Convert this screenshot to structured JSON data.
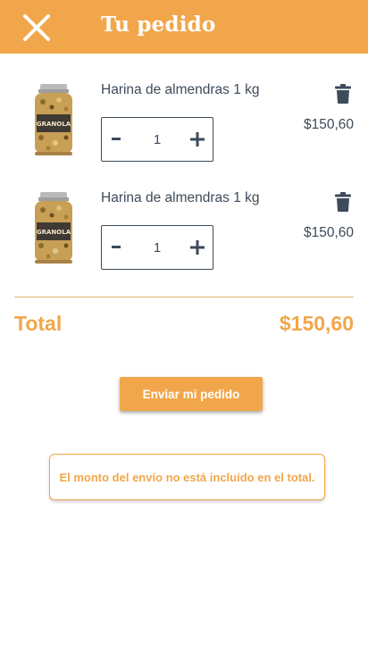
{
  "header": {
    "title": "Tu pedido",
    "close_icon": "close-icon",
    "background": "#f2a64b"
  },
  "cart": {
    "items": [
      {
        "name": "Harina de almendras 1 kg",
        "jar_label": "GRANOLA",
        "quantity": "1",
        "price": "$150,60",
        "minus_label": "-",
        "plus_label": "+",
        "delete_icon": "trash-icon"
      },
      {
        "name": "Harina de almendras 1 kg",
        "jar_label": "GRANOLA",
        "quantity": "1",
        "price": "$150,60",
        "minus_label": "-",
        "plus_label": "+",
        "delete_icon": "trash-icon"
      }
    ]
  },
  "summary": {
    "total_label": "Total",
    "total_value": "$150,60"
  },
  "actions": {
    "send_label": "Enviar mi pedido"
  },
  "notice": {
    "text": "El monto del envío no está incluído en el total."
  },
  "colors": {
    "accent": "#f2a64b",
    "text": "#3d4b5a"
  }
}
